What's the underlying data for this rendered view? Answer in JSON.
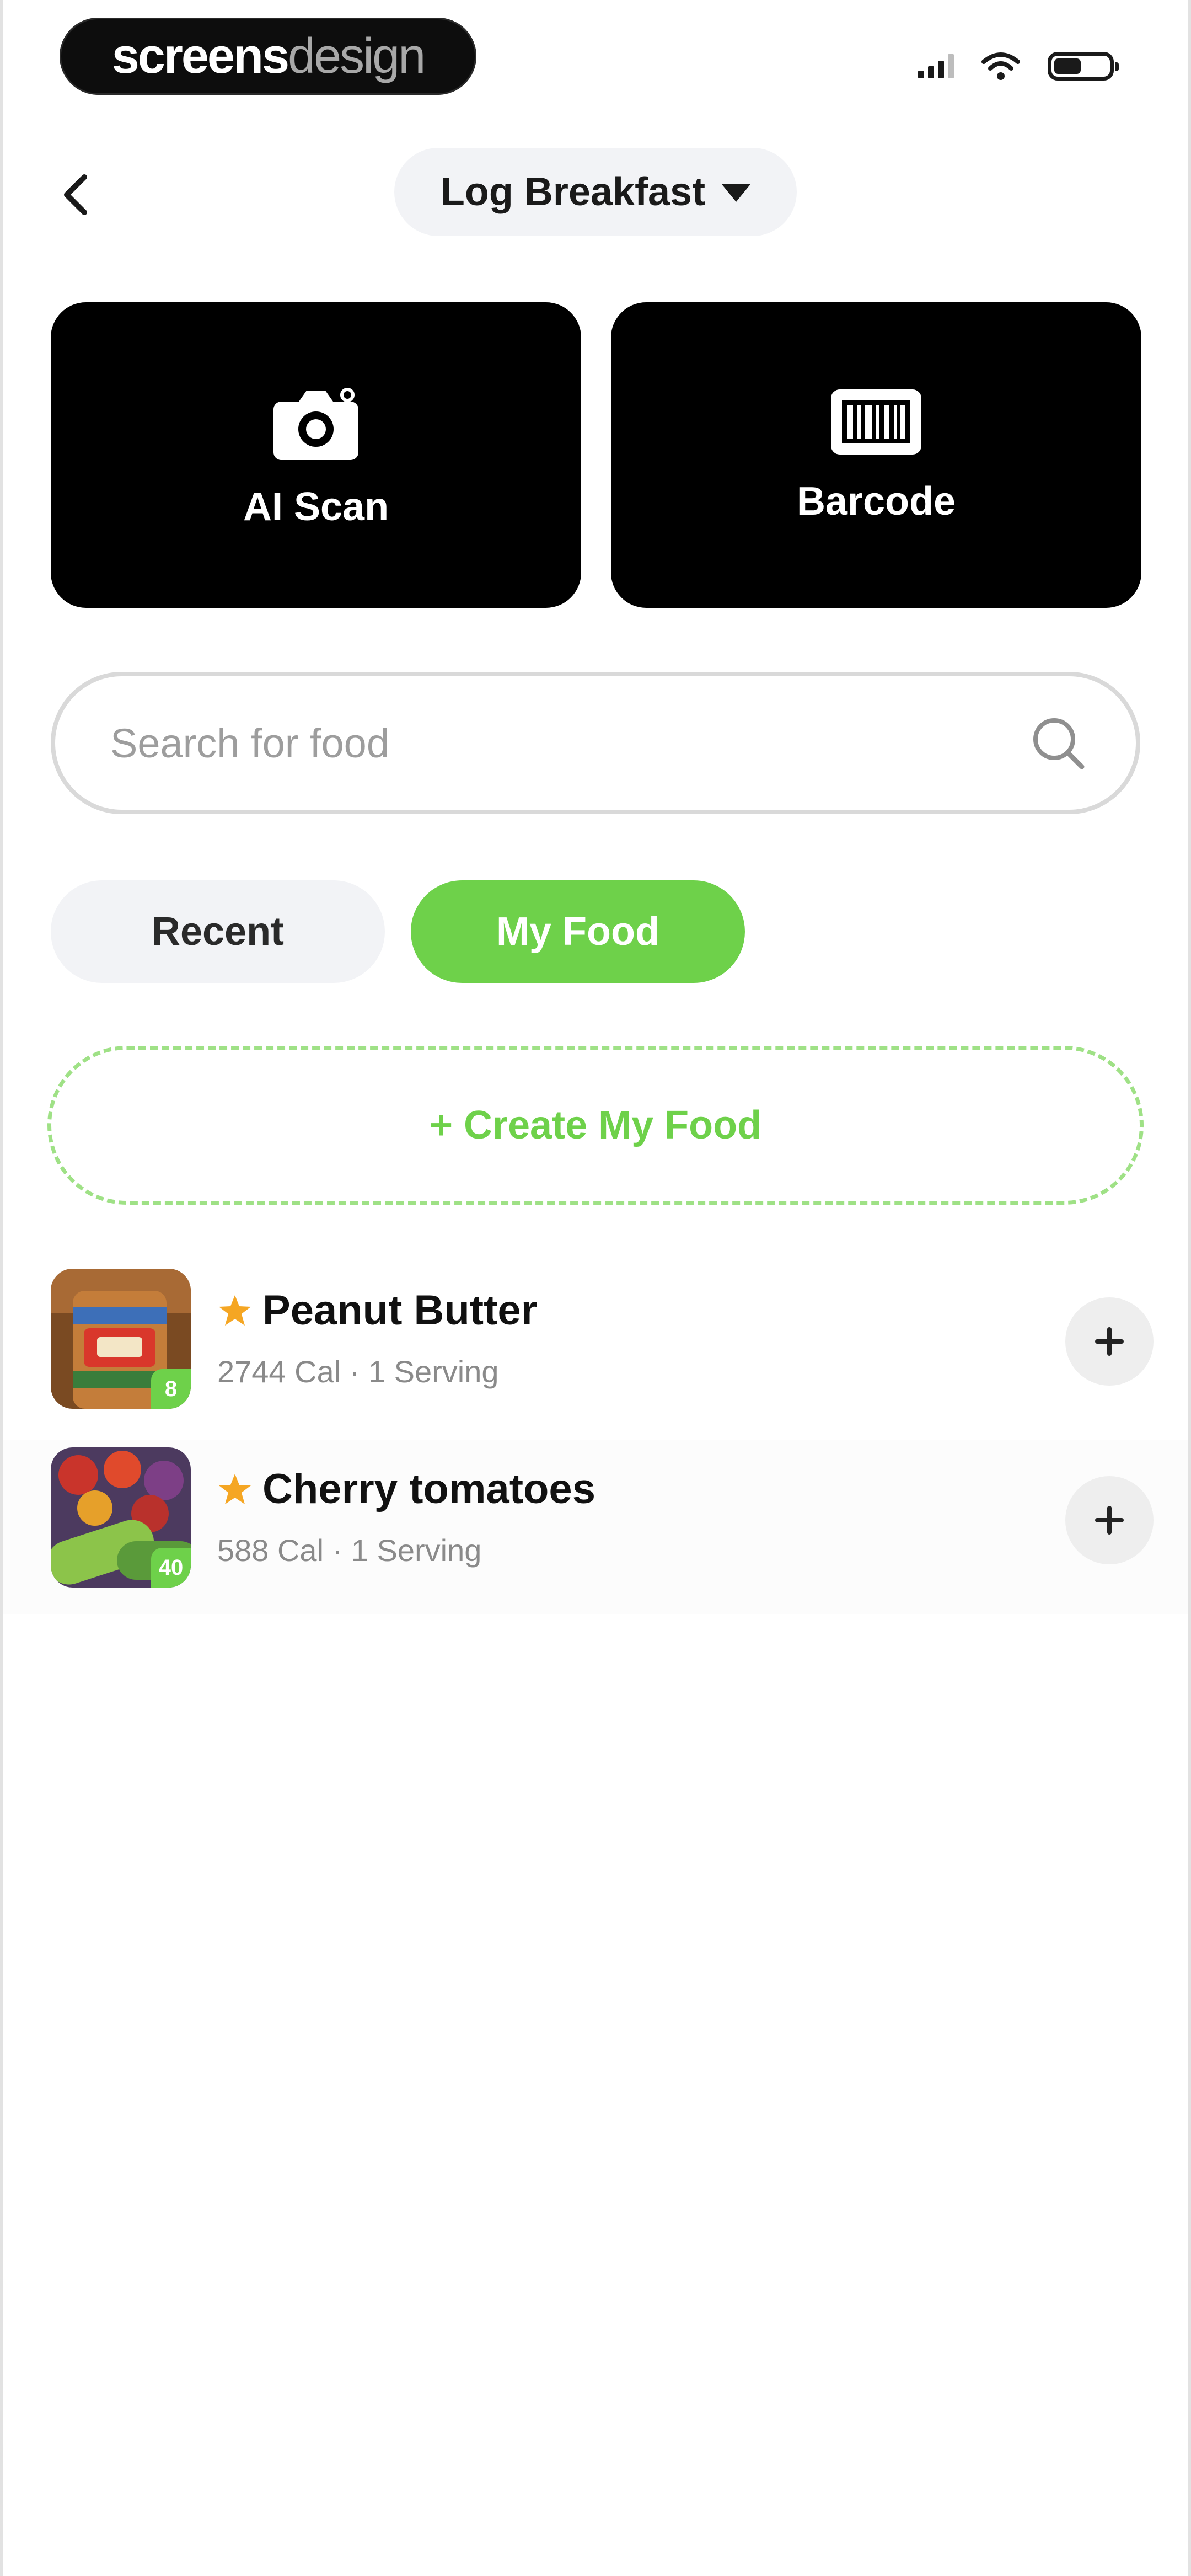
{
  "status_bar": {
    "brand_primary": "screens",
    "brand_secondary": "design"
  },
  "header": {
    "meal_selector": "Log Breakfast"
  },
  "actions": [
    {
      "label": "AI Scan",
      "icon": "camera-icon"
    },
    {
      "label": "Barcode",
      "icon": "barcode-icon"
    }
  ],
  "search": {
    "placeholder": "Search for food",
    "value": ""
  },
  "tabs": [
    {
      "label": "Recent",
      "active": false
    },
    {
      "label": "My Food",
      "active": true
    }
  ],
  "create_button": {
    "label": "+ Create My Food"
  },
  "foods": [
    {
      "name": "Peanut Butter",
      "meta": "2744  Cal · 1 Serving",
      "favorite": true,
      "thumb_badge": "8"
    },
    {
      "name": "Cherry tomatoes",
      "meta": "588  Cal · 1 Serving",
      "favorite": true,
      "thumb_badge": "40"
    }
  ],
  "colors": {
    "accent": "#6ed14a",
    "card_bg": "#000000",
    "chip_bg": "#f2f3f6",
    "star": "#f5a623"
  }
}
